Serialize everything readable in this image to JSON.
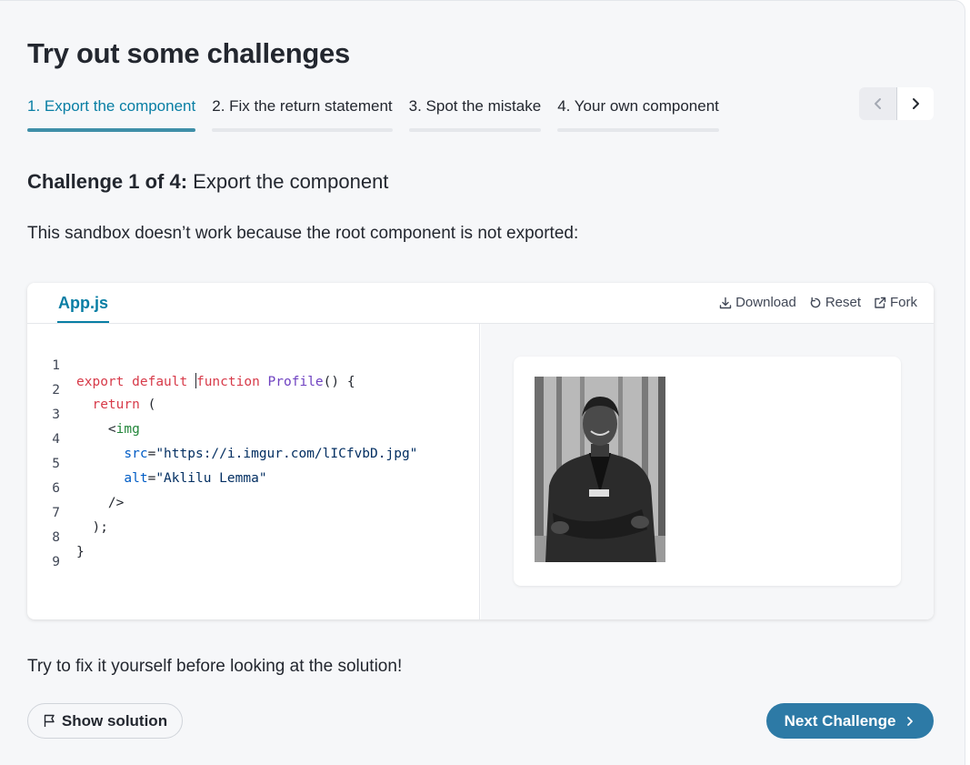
{
  "page": {
    "title": "Try out some challenges"
  },
  "tabs": [
    {
      "label": "1. Export the component",
      "active": true
    },
    {
      "label": "2. Fix the return statement",
      "active": false
    },
    {
      "label": "3. Spot the mistake",
      "active": false
    },
    {
      "label": "4. Your own component",
      "active": false
    }
  ],
  "pager": {
    "prev_icon": "chevron-left-icon",
    "next_icon": "chevron-right-icon"
  },
  "challenge": {
    "counter": "Challenge 1 of 4:",
    "name": "Export the component",
    "description": "This sandbox doesn’t work because the root component is not exported:"
  },
  "sandbox": {
    "file_tab": "App.js",
    "actions": {
      "download": "Download",
      "reset": "Reset",
      "fork": "Fork"
    },
    "line_numbers": [
      "1",
      "2",
      "3",
      "4",
      "5",
      "6",
      "7",
      "8",
      "9"
    ],
    "code": {
      "l1_kw1": "export",
      "l1_kw2": "default",
      "l1_kw3": "function",
      "l1_fn": "Profile",
      "l1_rest": "() {",
      "l2_kw": "return",
      "l2_rest": " (",
      "l3_lt": "<",
      "l3_tag": "img",
      "l4_attr": "src",
      "l4_eq": "=",
      "l4_str": "\"https://i.imgur.com/lICfvbD.jpg\"",
      "l5_attr": "alt",
      "l5_eq": "=",
      "l5_str": "\"Aklilu Lemma\"",
      "l6": "/>",
      "l7": ");",
      "l8": "}"
    },
    "preview_image_alt": "Aklilu Lemma"
  },
  "hint": "Try to fix it yourself before looking at the solution!",
  "buttons": {
    "show_solution": "Show solution",
    "next_challenge": "Next Challenge"
  },
  "colors": {
    "accent": "#087ea4",
    "next_button": "#2d7aa6",
    "keyword": "#d73a49",
    "function": "#6f42c1"
  }
}
